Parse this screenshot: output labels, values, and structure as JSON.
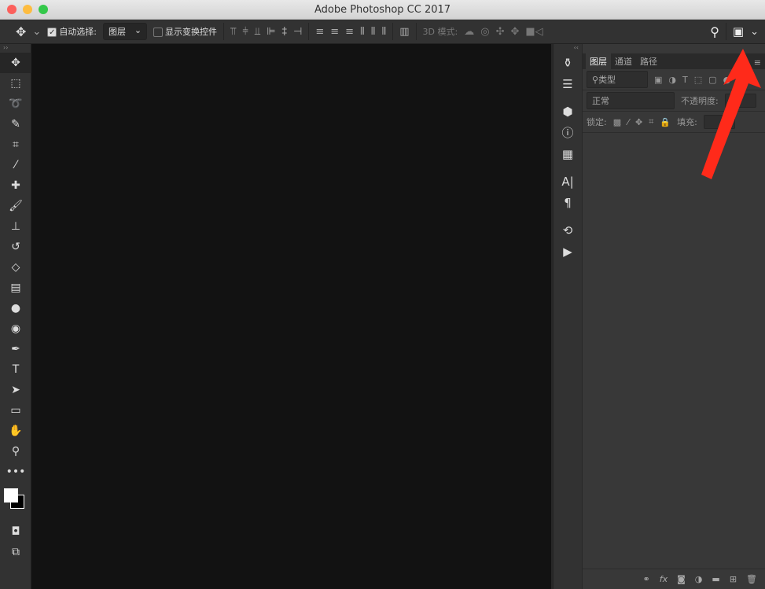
{
  "window": {
    "title": "Adobe Photoshop CC 2017"
  },
  "options": {
    "auto_select_label": "自动选择:",
    "auto_select_checked": true,
    "auto_select_value": "图层",
    "show_transform_label": "显示变换控件",
    "show_transform_checked": false,
    "mode_3d_label": "3D 模式:"
  },
  "panel": {
    "tabs": [
      "图层",
      "通道",
      "路径"
    ],
    "active_tab": "图层",
    "filter_kind": "类型",
    "blend_mode": "正常",
    "opacity_label": "不透明度:",
    "lock_label": "锁定:",
    "fill_label": "填充:"
  },
  "colors": {
    "accent_arrow": "#ff2a1a",
    "canvas": "#121212",
    "panel": "#383838"
  }
}
